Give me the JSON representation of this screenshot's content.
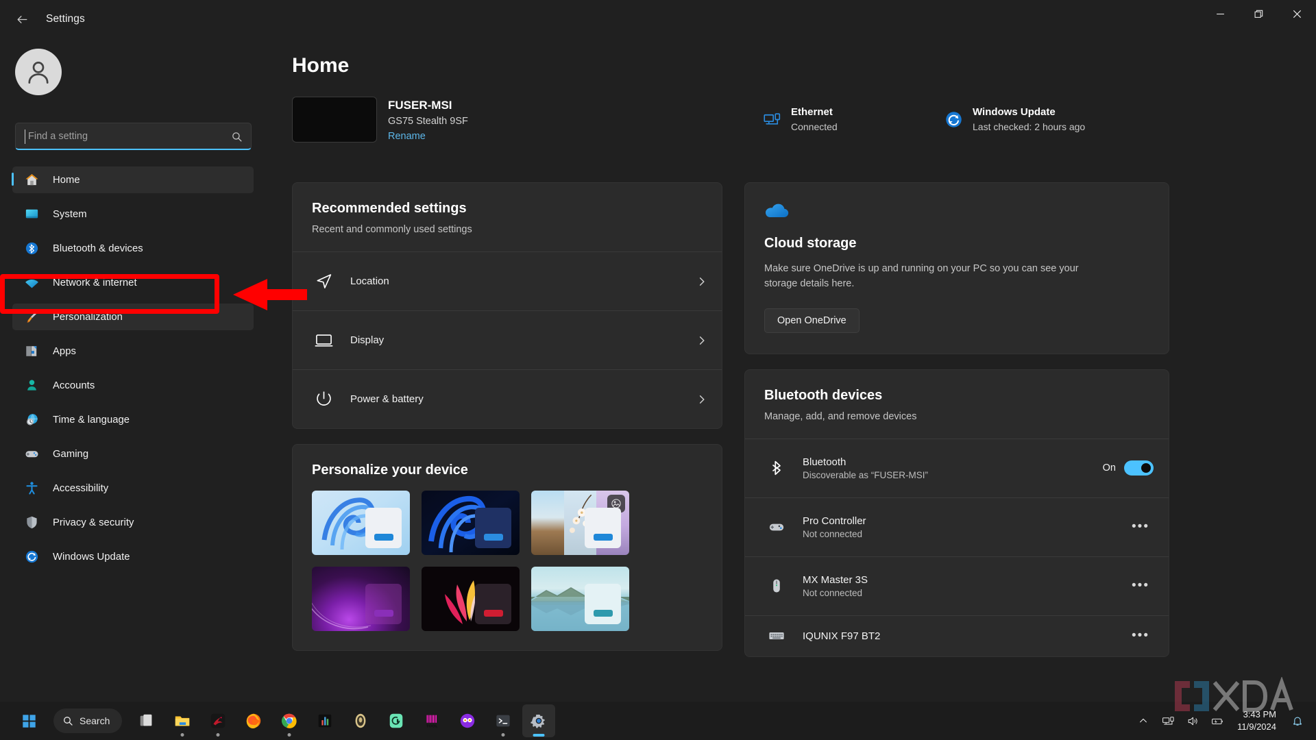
{
  "window": {
    "title": "Settings",
    "back_icon": "back-arrow-icon",
    "minimize_label": "Minimize",
    "maximize_label": "Restore",
    "close_label": "Close"
  },
  "sidebar": {
    "avatar_name": "user-avatar",
    "search": {
      "placeholder": "Find a setting",
      "value": "",
      "icon": "search-icon"
    },
    "items": [
      {
        "label": "Home",
        "icon": "home-icon",
        "active": true
      },
      {
        "label": "System",
        "icon": "system-icon",
        "active": false
      },
      {
        "label": "Bluetooth & devices",
        "icon": "bluetooth-icon",
        "active": false
      },
      {
        "label": "Network & internet",
        "icon": "network-icon",
        "active": false
      },
      {
        "label": "Personalization",
        "icon": "personalization-icon",
        "active": false,
        "highlighted": true
      },
      {
        "label": "Apps",
        "icon": "apps-icon",
        "active": false
      },
      {
        "label": "Accounts",
        "icon": "accounts-icon",
        "active": false
      },
      {
        "label": "Time & language",
        "icon": "time-language-icon",
        "active": false
      },
      {
        "label": "Gaming",
        "icon": "gaming-icon",
        "active": false
      },
      {
        "label": "Accessibility",
        "icon": "accessibility-icon",
        "active": false
      },
      {
        "label": "Privacy & security",
        "icon": "privacy-security-icon",
        "active": false
      },
      {
        "label": "Windows Update",
        "icon": "windows-update-icon",
        "active": false
      }
    ]
  },
  "main": {
    "page_title": "Home",
    "device": {
      "name": "FUSER-MSI",
      "model": "GS75 Stealth 9SF",
      "rename_label": "Rename"
    },
    "status": [
      {
        "title": "Ethernet",
        "subtitle": "Connected",
        "icon": "ethernet-icon"
      },
      {
        "title": "Windows Update",
        "subtitle": "Last checked: 2 hours ago",
        "icon": "windows-update-icon"
      }
    ],
    "recommended": {
      "title": "Recommended settings",
      "subtitle": "Recent and commonly used settings",
      "rows": [
        {
          "label": "Location",
          "icon": "location-icon"
        },
        {
          "label": "Display",
          "icon": "display-icon"
        },
        {
          "label": "Power & battery",
          "icon": "power-icon"
        }
      ]
    },
    "personalize": {
      "title": "Personalize your device",
      "thumbs": [
        {
          "name": "wallpaper-bloom-light",
          "badge": null
        },
        {
          "name": "wallpaper-bloom-dark",
          "badge": null
        },
        {
          "name": "wallpaper-slideshow-trio",
          "badge": "picture-icon"
        },
        {
          "name": "wallpaper-purple-glow",
          "badge": null
        },
        {
          "name": "wallpaper-flow-color",
          "badge": null
        },
        {
          "name": "wallpaper-lake-reflection",
          "badge": null
        }
      ]
    },
    "cloud": {
      "icon": "onedrive-cloud-icon",
      "title": "Cloud storage",
      "body": "Make sure OneDrive is up and running on your PC so you can see your storage details here.",
      "button_label": "Open OneDrive"
    },
    "bluetooth": {
      "title": "Bluetooth devices",
      "subtitle": "Manage, add, and remove devices",
      "toggle_row": {
        "name": "Bluetooth",
        "sub": "Discoverable as “FUSER-MSI”",
        "state_label": "On",
        "icon": "bluetooth-icon"
      },
      "devices": [
        {
          "name": "Pro Controller",
          "status": "Not connected",
          "icon": "gamepad-icon",
          "menu": "•••"
        },
        {
          "name": "MX Master 3S",
          "status": "Not connected",
          "icon": "mouse-icon",
          "menu": "•••"
        },
        {
          "name": "IQUNIX F97 BT2",
          "status": "",
          "icon": "keyboard-icon",
          "menu": "•••"
        }
      ]
    }
  },
  "taskbar": {
    "start_label": "Start",
    "search_label": "Search",
    "search_icon": "search-icon",
    "apps": [
      {
        "name": "task-view",
        "running": false
      },
      {
        "name": "file-explorer",
        "running": true
      },
      {
        "name": "msi-dragon-center",
        "running": true
      },
      {
        "name": "firefox",
        "running": false
      },
      {
        "name": "google-chrome",
        "running": true
      },
      {
        "name": "analytics-app",
        "running": false
      },
      {
        "name": "oculus-app",
        "running": false
      },
      {
        "name": "green-app",
        "running": false
      },
      {
        "name": "tool-app",
        "running": false
      },
      {
        "name": "purple-app",
        "running": false
      },
      {
        "name": "terminal",
        "running": true
      },
      {
        "name": "settings",
        "running": true,
        "active": true
      }
    ],
    "tray": {
      "chevron_icon": "show-hidden-icons-icon",
      "network_icon": "ethernet-tray-icon",
      "volume_icon": "volume-icon",
      "battery_icon": "battery-charging-icon",
      "time": "3:43 PM",
      "date": "11/9/2024",
      "notification_icon": "bell-icon"
    }
  },
  "annotation": {
    "target": "Personalization",
    "box_color": "#ff0000",
    "arrow_color": "#ff0000"
  },
  "watermark": {
    "text": "XDA"
  },
  "colors": {
    "accent": "#4cc2ff",
    "window_bg": "#202020",
    "card_bg": "#2b2b2b",
    "taskbar_bg": "#1c1c1c",
    "link": "#5cb6e8",
    "annotation": "#ff0000"
  }
}
